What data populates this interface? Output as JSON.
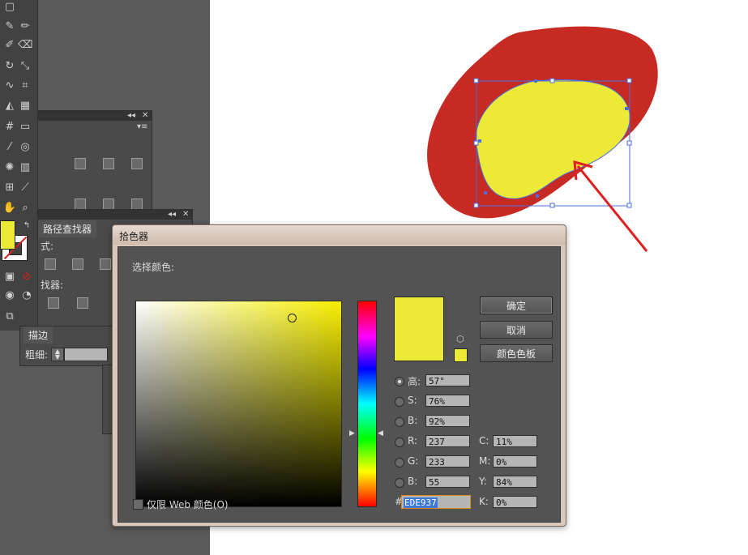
{
  "colors": {
    "selected": "#ede937",
    "shape_red": "#c62a22",
    "bounding_box": "#4a6ee0"
  },
  "panels": {
    "pathfinder": {
      "tab_label": "路径查找器",
      "shape_modes_label": "式:",
      "pathfinders_label": "找器:"
    },
    "stroke": {
      "tab_label": "描边",
      "weight_label": "粗细:"
    }
  },
  "dialog": {
    "title": "拾色器",
    "select_color_label": "选择颜色:",
    "buttons": {
      "ok": "确定",
      "cancel": "取消",
      "swatches": "颜色色板"
    },
    "fields": {
      "H": {
        "label": "高:",
        "value": "57°"
      },
      "S": {
        "label": "S:",
        "value": "76%"
      },
      "B": {
        "label": "B:",
        "value": "92%"
      },
      "R": {
        "label": "R:",
        "value": "237"
      },
      "G": {
        "label": "G:",
        "value": "233"
      },
      "Bb": {
        "label": "B:",
        "value": "55"
      },
      "C": {
        "label": "C:",
        "value": "11%"
      },
      "M": {
        "label": "M:",
        "value": "0%"
      },
      "Y": {
        "label": "Y:",
        "value": "84%"
      },
      "K": {
        "label": "K:",
        "value": "0%"
      }
    },
    "hex": {
      "label": "#",
      "value": "EDE937"
    },
    "web_only_label": "仅限 Web 颜色(O)"
  }
}
